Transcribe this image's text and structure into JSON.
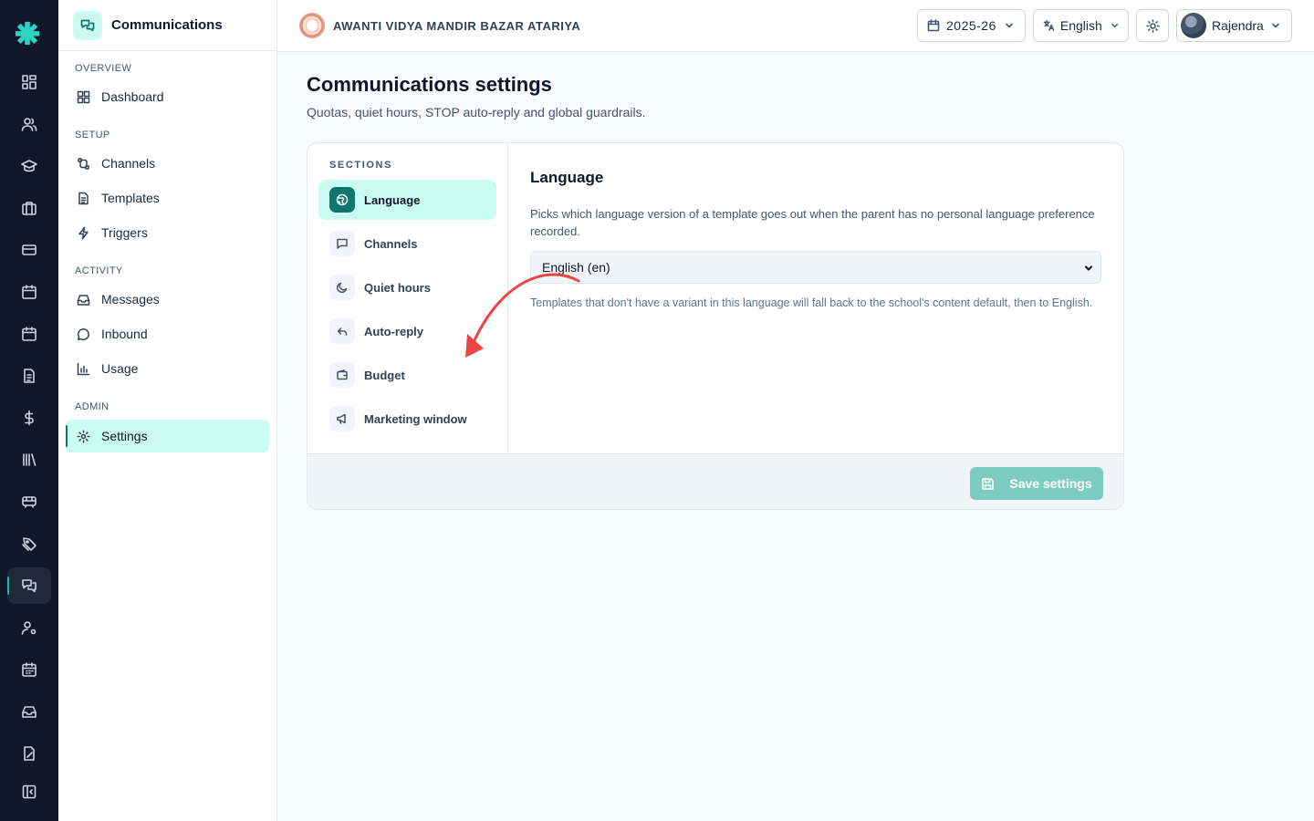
{
  "rail": {
    "items": [
      "dashboard-icon",
      "students-icon",
      "academics-icon",
      "briefcase-icon",
      "card-icon",
      "calendar-icon",
      "calendar-alt-icon",
      "document-icon",
      "dollar-icon",
      "library-icon",
      "bus-icon",
      "tag-icon",
      "communications-icon",
      "user-settings-icon",
      "timetable-icon",
      "inbox-icon",
      "certificate-icon",
      "collapse-icon"
    ]
  },
  "sidebar": {
    "title": "Communications",
    "groups": {
      "overview": "OVERVIEW",
      "setup": "SETUP",
      "activity": "ACTIVITY",
      "admin": "ADMIN"
    },
    "items": {
      "dashboard": "Dashboard",
      "channels": "Channels",
      "templates": "Templates",
      "triggers": "Triggers",
      "messages": "Messages",
      "inbound": "Inbound",
      "usage": "Usage",
      "settings": "Settings"
    },
    "active": "Settings"
  },
  "topbar": {
    "school_name": "AWANTI VIDYA MANDIR BAZAR ATARIYA",
    "year": "2025-26",
    "language": "English",
    "user": "Rajendra"
  },
  "page": {
    "title": "Communications settings",
    "subtitle": "Quotas, quiet hours, STOP auto-reply and global guardrails."
  },
  "sections": {
    "label": "SECTIONS",
    "items": [
      "Language",
      "Channels",
      "Quiet hours",
      "Auto-reply",
      "Budget",
      "Marketing window"
    ],
    "active": "Language"
  },
  "pane": {
    "title": "Language",
    "description": "Picks which language version of a template goes out when the parent has no personal language preference recorded.",
    "selected_language": "English (en)",
    "note": "Templates that don't have a variant in this language will fall back to the school's content default, then to English."
  },
  "footer": {
    "save_label": "Save settings"
  },
  "colors": {
    "rail_bg": "#0f172a",
    "accent": "#0f766e",
    "accent_light": "#ccfbf1",
    "save_disabled": "#7dccc2",
    "annotation_arrow": "#ef4444"
  }
}
